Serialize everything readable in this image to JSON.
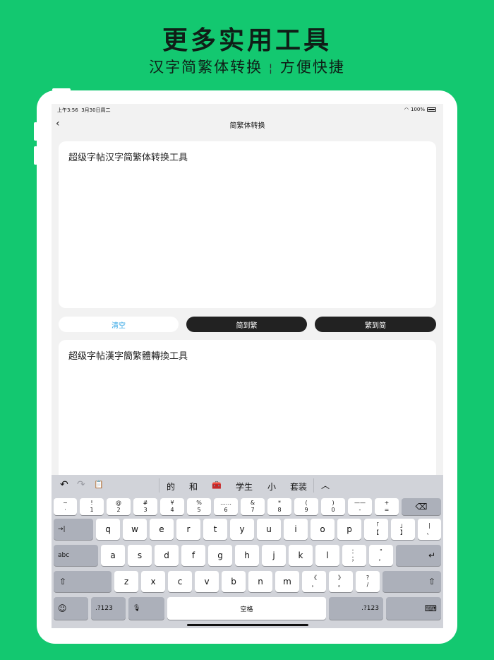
{
  "promo": {
    "headline": "更多实用工具",
    "subline_left": "汉字简繁体转换",
    "subline_sep": "¦",
    "subline_right": "方便快捷"
  },
  "status_bar": {
    "time": "上午3:56",
    "date": "3月30日周二",
    "battery": "100%"
  },
  "nav": {
    "back_icon": "‹",
    "title": "简繁体转换"
  },
  "input_panel": {
    "text": "超级字帖汉字简繁体转换工具"
  },
  "output_panel": {
    "text": "超级字帖漢字簡繁體轉換工具"
  },
  "actions": {
    "clear": "清空",
    "to_traditional": "简到繁",
    "to_simplified": "繁到简"
  },
  "colors": {
    "brand_green": "#13c870",
    "pill_dark": "#222222",
    "clear_text": "#3aa9e6"
  },
  "keyboard": {
    "toolbar": {
      "undo_icon": "↶",
      "redo_icon": "↷",
      "clipboard_icon": "📋",
      "suggestions": [
        "的",
        "和",
        "🧰",
        "学生",
        "小",
        "套装"
      ],
      "collapse_icon": "︿"
    },
    "row_numbers": [
      {
        "top": "~",
        "bottom": "·"
      },
      {
        "top": "!",
        "bottom": "1"
      },
      {
        "top": "@",
        "bottom": "2"
      },
      {
        "top": "#",
        "bottom": "3"
      },
      {
        "top": "¥",
        "bottom": "4"
      },
      {
        "top": "%",
        "bottom": "5"
      },
      {
        "top": "……",
        "bottom": "6"
      },
      {
        "top": "&",
        "bottom": "7"
      },
      {
        "top": "*",
        "bottom": "8"
      },
      {
        "top": "(",
        "bottom": "9"
      },
      {
        "top": ")",
        "bottom": "0"
      },
      {
        "top": "——",
        "bottom": "-"
      },
      {
        "top": "+",
        "bottom": "="
      }
    ],
    "delete_icon": "⌫",
    "tab_icon": "→|",
    "row_q": [
      "q",
      "w",
      "e",
      "r",
      "t",
      "y",
      "u",
      "i",
      "o",
      "p"
    ],
    "row_q_extra": [
      {
        "top": "「",
        "bottom": "【"
      },
      {
        "top": "」",
        "bottom": "】"
      },
      {
        "top": "|",
        "bottom": "、"
      }
    ],
    "abc_label": "abc",
    "row_a": [
      "a",
      "s",
      "d",
      "f",
      "g",
      "h",
      "j",
      "k",
      "l"
    ],
    "row_a_extra": [
      {
        "top": "：",
        "bottom": "；"
      },
      {
        "top": "\"",
        "bottom": "，"
      }
    ],
    "return_icon": "↵",
    "shift_icon": "⇧",
    "row_z": [
      "z",
      "x",
      "c",
      "v",
      "b",
      "n",
      "m"
    ],
    "row_z_extra": [
      {
        "top": "《",
        "bottom": "，"
      },
      {
        "top": "》",
        "bottom": "。"
      },
      {
        "top": "?",
        "bottom": "/"
      }
    ],
    "emoji_icon": "☺",
    "num_label": ".?123",
    "mic_icon": "🎙",
    "space_label": "空格",
    "num_label_right": ".?123",
    "hide_keyboard_icon": "⌨"
  }
}
